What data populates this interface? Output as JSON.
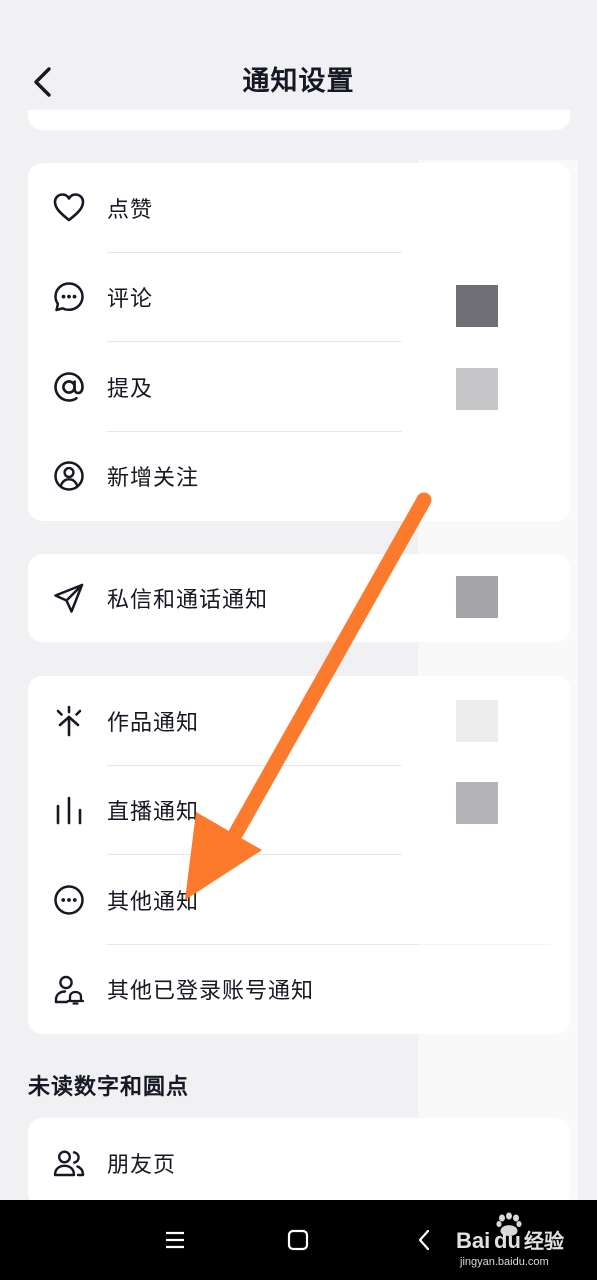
{
  "header": {
    "title": "通知设置"
  },
  "groups": [
    {
      "items": [
        {
          "label": "点赞",
          "icon": "heart-icon"
        },
        {
          "label": "评论",
          "icon": "comment-icon"
        },
        {
          "label": "提及",
          "icon": "at-icon"
        },
        {
          "label": "新增关注",
          "icon": "user-circle-icon"
        }
      ]
    },
    {
      "items": [
        {
          "label": "私信和通话通知",
          "icon": "paper-plane-icon"
        }
      ]
    },
    {
      "items": [
        {
          "label": "作品通知",
          "icon": "spark-icon"
        },
        {
          "label": "直播通知",
          "icon": "bars-icon"
        },
        {
          "label": "其他通知",
          "icon": "more-circle-icon"
        },
        {
          "label": "其他已登录账号通知",
          "icon": "account-bell-icon"
        }
      ]
    }
  ],
  "section": {
    "title": "未读数字和圆点"
  },
  "friends": {
    "label": "朋友页",
    "icon": "friends-icon"
  },
  "colors": {
    "arrow": "#fb7a2c",
    "background": "#f1f1f3",
    "card": "#ffffff",
    "text": "#161823"
  },
  "watermark": {
    "brand": "Bai",
    "brand_suffix": "du",
    "product": "经验",
    "url": "jingyan.baidu.com"
  }
}
